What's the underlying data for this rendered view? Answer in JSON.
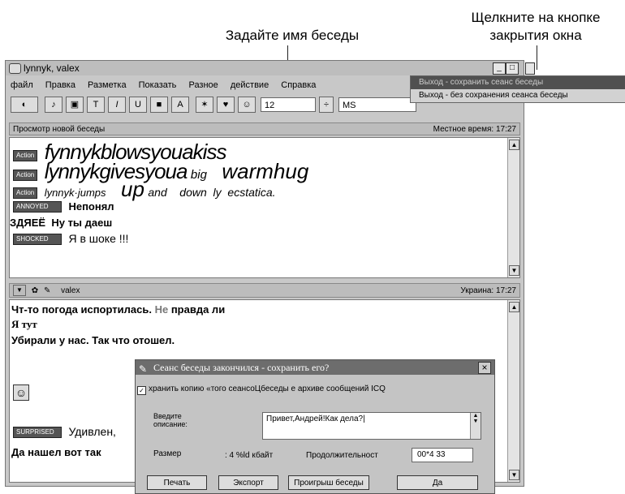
{
  "callouts": {
    "set_name": "Задайте имя беседы",
    "close_window": "Щелкните на кнопке закрытия окна"
  },
  "window": {
    "title": "lynnyk, valex",
    "menu": [
      "файл",
      "Правка",
      "Разметка",
      "Показать",
      "Разное",
      "действие",
      "Справка"
    ],
    "font_size": "12",
    "font_name": "MS",
    "buttons": {
      "minimize": "_",
      "restore": "□"
    }
  },
  "close_menu": {
    "items": [
      "Выход - сохранить сеанс беседы",
      "Выход - без сохранения сеанса беседы"
    ]
  },
  "top_pane": {
    "header": "Просмотр новой беседы",
    "local_time": "Местное время: 17:27",
    "messages": [
      {
        "tag": "Action",
        "text": "fynnykblowsyouakiss"
      },
      {
        "tag": "Action",
        "text": "lynnykgivesyoua",
        "extra_small": "big",
        "extra_large": "warmhug"
      },
      {
        "tag": "Action",
        "text": "lynnyk·jumps",
        "extra_large": "up",
        "extra_small": "and    down  ly  ecstatica."
      },
      {
        "tag": "ANNOYED",
        "text": "Непонял"
      },
      {
        "tag": "",
        "text": "ЗДЯЕЁ  Ну ты даеш"
      },
      {
        "tag": "SHOCKED",
        "text": "Я в шоке !!!"
      }
    ]
  },
  "bottom_pane": {
    "user": "valex",
    "location": "Украина: 17:27",
    "messages": [
      {
        "text": "Чт-то погода испортилась.",
        "text_gray": "Не",
        "text_after": "правда ли"
      },
      {
        "text": "Я тут"
      },
      {
        "text": "Убирали у нас. Так что отошел."
      },
      {
        "tag": "SURPRISED",
        "text": "Удивлен,"
      },
      {
        "text": "Да нашел вот так"
      }
    ]
  },
  "dialog": {
    "title": "Сеанс беседы закончился - сохранить его?",
    "close": "×",
    "checkbox_label": "хранить копию «того сеансоЦбеседы е архиве сообщений ICQ",
    "desc_label": "Введите описание:",
    "desc_value": "Привет,Андрей!Как дела?|",
    "size_label": "Размер",
    "size_value": ": 4 %ld кбайт",
    "duration_label": "Продолжительност",
    "duration_value": "00*4 33",
    "buttons": [
      "Печать",
      "Экспорт",
      "Проигрыш беседы",
      "Да"
    ]
  }
}
